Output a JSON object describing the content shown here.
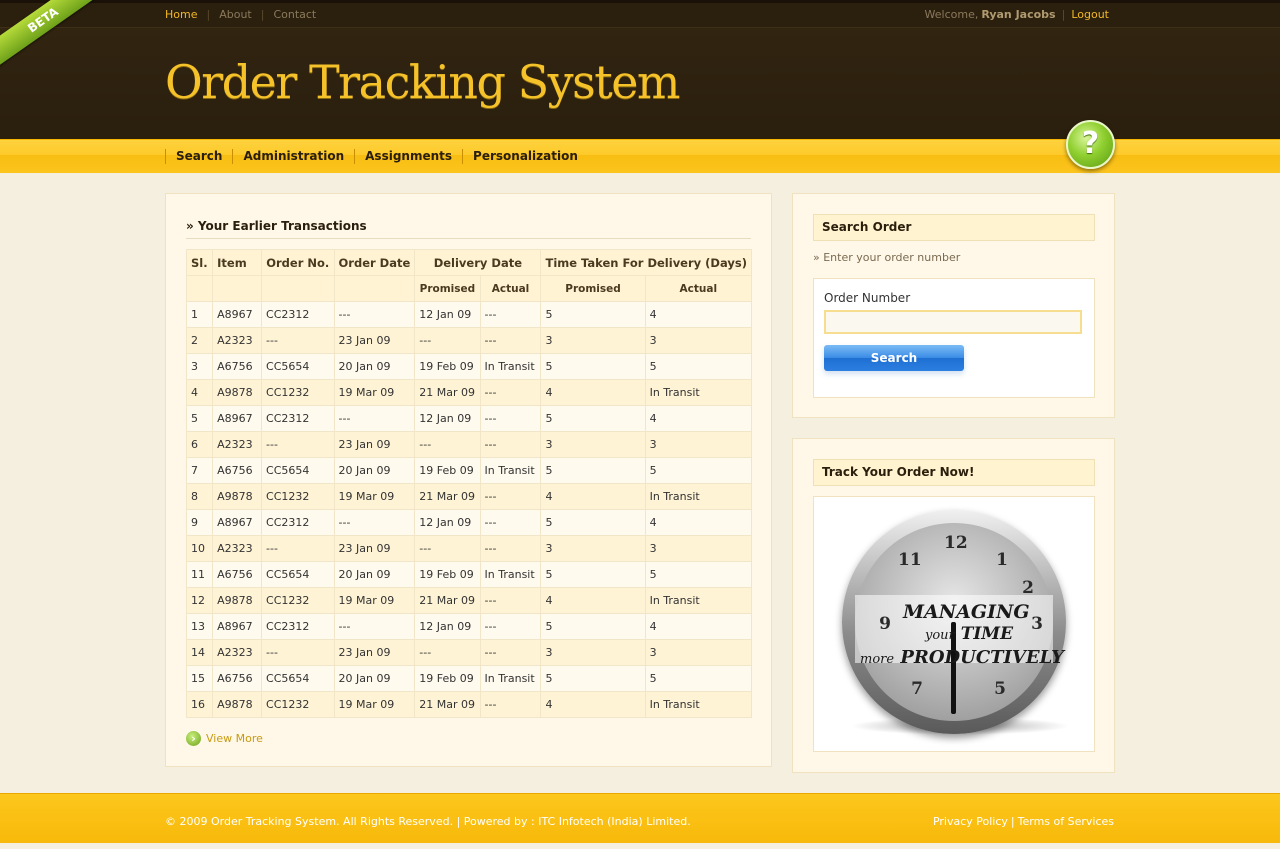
{
  "badge": "BETA",
  "topnav": {
    "links": [
      {
        "label": "Home",
        "active": true
      },
      {
        "label": "About",
        "active": false
      },
      {
        "label": "Contact",
        "active": false
      }
    ]
  },
  "user": {
    "welcome": "Welcome,",
    "name": "Ryan Jacobs",
    "logout": "Logout"
  },
  "site_title": "Order Tracking System",
  "nav": {
    "items": [
      "Search",
      "Administration",
      "Assignments",
      "Personalization"
    ]
  },
  "help_icon": "?",
  "transactions": {
    "title": "» Your Earlier Transactions",
    "headers": {
      "sl": "Sl.",
      "item": "Item",
      "order_no": "Order No.",
      "order_date": "Order Date",
      "delivery_date": "Delivery Date",
      "time_taken": "Time Taken For Delivery (Days)",
      "promised": "Promised",
      "actual": "Actual"
    },
    "rows": [
      [
        "1",
        "A8967",
        "CC2312",
        "---",
        "12 Jan 09",
        "---",
        "5",
        "4"
      ],
      [
        "2",
        "A2323",
        "---",
        "23 Jan 09",
        "---",
        "---",
        "3",
        "3"
      ],
      [
        "3",
        "A6756",
        "CC5654",
        "20 Jan 09",
        "19 Feb 09",
        "In Transit",
        "5",
        "5"
      ],
      [
        "4",
        "A9878",
        "CC1232",
        "19 Mar 09",
        "21 Mar 09",
        "---",
        "4",
        "In Transit"
      ],
      [
        "5",
        "A8967",
        "CC2312",
        "---",
        "12 Jan 09",
        "---",
        "5",
        "4"
      ],
      [
        "6",
        "A2323",
        "---",
        "23 Jan 09",
        "---",
        "---",
        "3",
        "3"
      ],
      [
        "7",
        "A6756",
        "CC5654",
        "20 Jan 09",
        "19 Feb 09",
        "In Transit",
        "5",
        "5"
      ],
      [
        "8",
        "A9878",
        "CC1232",
        "19 Mar 09",
        "21 Mar 09",
        "---",
        "4",
        "In Transit"
      ],
      [
        "9",
        "A8967",
        "CC2312",
        "---",
        "12 Jan 09",
        "---",
        "5",
        "4"
      ],
      [
        "10",
        "A2323",
        "---",
        "23 Jan 09",
        "---",
        "---",
        "3",
        "3"
      ],
      [
        "11",
        "A6756",
        "CC5654",
        "20 Jan 09",
        "19 Feb 09",
        "In Transit",
        "5",
        "5"
      ],
      [
        "12",
        "A9878",
        "CC1232",
        "19 Mar 09",
        "21 Mar 09",
        "---",
        "4",
        "In Transit"
      ],
      [
        "13",
        "A8967",
        "CC2312",
        "---",
        "12 Jan 09",
        "---",
        "5",
        "4"
      ],
      [
        "14",
        "A2323",
        "---",
        "23 Jan 09",
        "---",
        "---",
        "3",
        "3"
      ],
      [
        "15",
        "A6756",
        "CC5654",
        "20 Jan 09",
        "19 Feb 09",
        "In Transit",
        "5",
        "5"
      ],
      [
        "16",
        "A9878",
        "CC1232",
        "19 Mar 09",
        "21 Mar 09",
        "---",
        "4",
        "In Transit"
      ]
    ],
    "view_more": "View More"
  },
  "search_order": {
    "title": "Search Order",
    "hint": "» Enter your order number",
    "field_label": "Order Number",
    "field_value": "",
    "button": "Search"
  },
  "track": {
    "title": "Track Your Order Now!",
    "image_text": {
      "line1": "MANAGING",
      "line2_small": "your",
      "line2": "TIME",
      "line3_small": "more",
      "line3": "PRODUCTIVELY"
    },
    "clock_numbers": [
      "12",
      "1",
      "2",
      "3",
      "5",
      "7",
      "9",
      "11"
    ]
  },
  "footer": {
    "copyright": "© 2009 Order Tracking System. All Rights Reserved. | Powered by : ITC Infotech (India) Limited.",
    "links": [
      "Privacy Policy",
      "Terms of Services"
    ],
    "separator": "|"
  },
  "colors": {
    "header_bg": "#2b1f0e",
    "accent_yellow": "#fdc71c",
    "title_gold": "#f6c22a",
    "button_blue": "#3a8be6"
  },
  "icons": [
    "beta-ribbon-icon",
    "help-icon",
    "view-more-arrow-icon"
  ]
}
